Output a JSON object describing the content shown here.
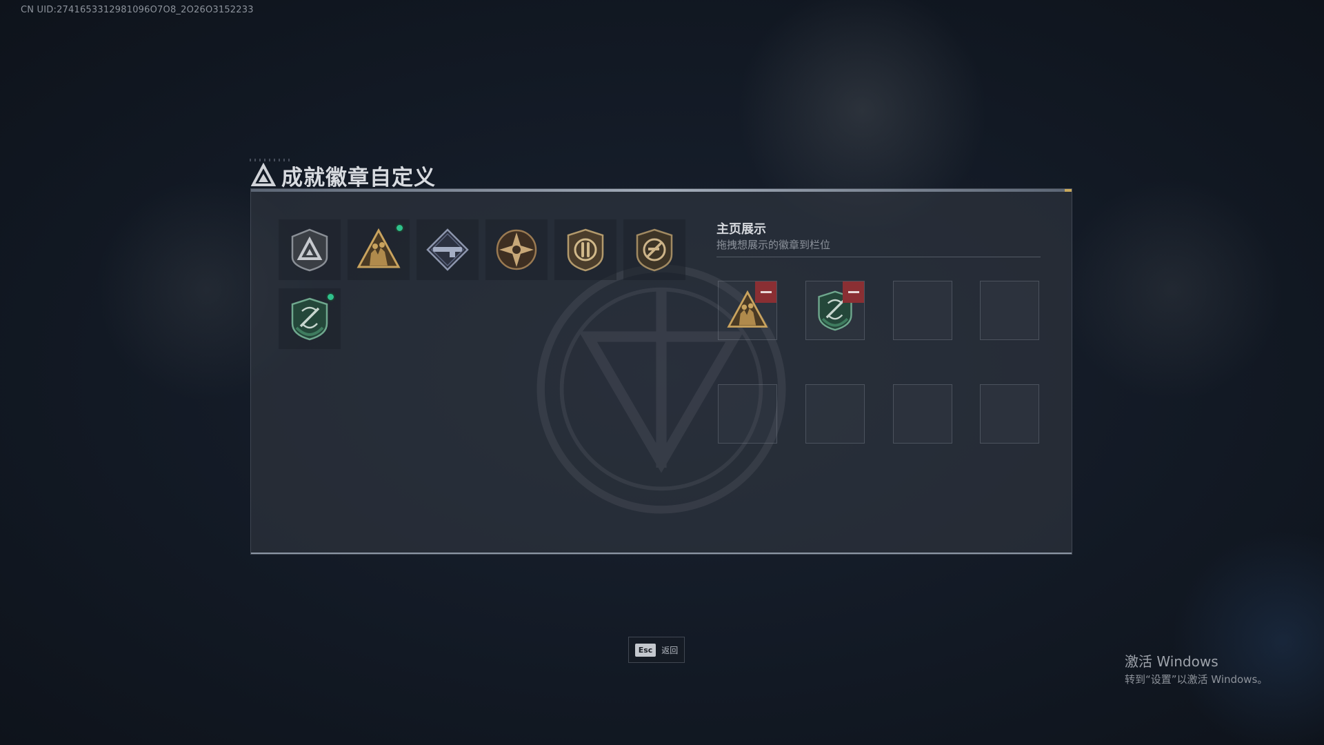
{
  "header": {
    "uid_text": "CN UID:2741653312981096O7O8_2O26O3152233"
  },
  "title": {
    "text": "成就徽章自定义",
    "icon": "triangle-logo-icon"
  },
  "badges": [
    {
      "name": "triangle-shield-badge",
      "new": false
    },
    {
      "name": "soldiers-triangle-badge",
      "new": true
    },
    {
      "name": "rifle-diamond-badge",
      "new": false
    },
    {
      "name": "star-compass-badge",
      "new": false
    },
    {
      "name": "bullet-shield-badge",
      "new": false
    },
    {
      "name": "no-weapon-shield-badge",
      "new": false
    },
    {
      "name": "green-swords-shield-badge",
      "new": true
    }
  ],
  "display": {
    "title": "主页展示",
    "subtitle": "拖拽想展示的徽章到栏位",
    "slots": [
      {
        "badge": "soldiers-triangle-badge",
        "removable": true
      },
      {
        "badge": "green-swords-shield-badge",
        "removable": true
      },
      {
        "badge": null
      },
      {
        "badge": null
      },
      {
        "badge": null
      },
      {
        "badge": null
      },
      {
        "badge": null
      },
      {
        "badge": null
      }
    ]
  },
  "footer": {
    "esc_key": "Esc",
    "esc_label": "返回"
  },
  "windows_notice": {
    "title": "激活 Windows",
    "subtitle": "转到“设置”以激活 Windows。"
  },
  "colors": {
    "new_dot": "#2fc18c",
    "remove_button": "#8a2f33",
    "accent_gold": "#c9a95c"
  }
}
